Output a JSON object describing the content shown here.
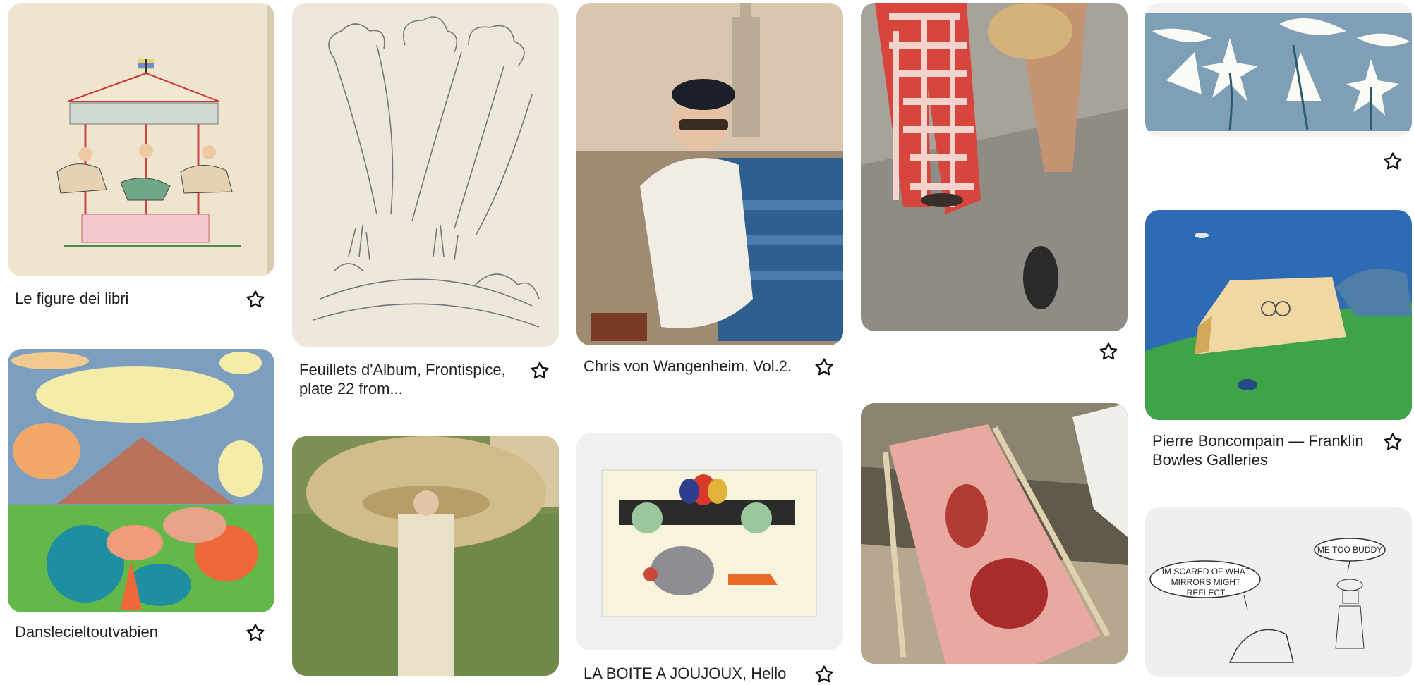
{
  "pins": [
    {
      "id": "c1a",
      "title": "Le figure dei libri",
      "image": "carousel illustration",
      "save_icon": "star-icon"
    },
    {
      "id": "c1b",
      "title": "Danslecieltoutvabien",
      "image": "clouds and trees collage",
      "save_icon": "star-icon"
    },
    {
      "id": "c2a",
      "title": "Feuillets d'Album, Frontispice, plate 22 from...",
      "image": "pencil tree sketch",
      "save_icon": "star-icon"
    },
    {
      "id": "c2b",
      "title": "",
      "image": "woman with giant straw hat",
      "save_icon": "star-icon"
    },
    {
      "id": "c3a",
      "title": "Chris von Wangenheim. Vol.2.",
      "image": "woman on bench in city",
      "save_icon": "star-icon"
    },
    {
      "id": "c3b",
      "title": "LA BOITE A JOUJOUX, Hello",
      "image": "children's book elephant illustration",
      "save_icon": "star-icon"
    },
    {
      "id": "c4a",
      "title": "",
      "image": "gingham trousers walking",
      "save_icon": "star-icon"
    },
    {
      "id": "c4b",
      "title": "",
      "image": "pink deck chair",
      "save_icon": "star-icon"
    },
    {
      "id": "c5a",
      "title": "",
      "image": "white lilies on blue",
      "save_icon": "star-icon"
    },
    {
      "id": "c5b",
      "title": "Pierre Boncompain — Franklin Bowles Galleries",
      "image": "painted landscape with house",
      "save_icon": "star-icon"
    },
    {
      "id": "c5c",
      "title": "",
      "image": "comic with speech bubbles",
      "save_icon": "star-icon"
    }
  ],
  "comic": {
    "bubble_left": "IM SCARED OF WHAT MIRRORS MIGHT REFLECT",
    "bubble_right": "ME TOO BUDDY"
  }
}
